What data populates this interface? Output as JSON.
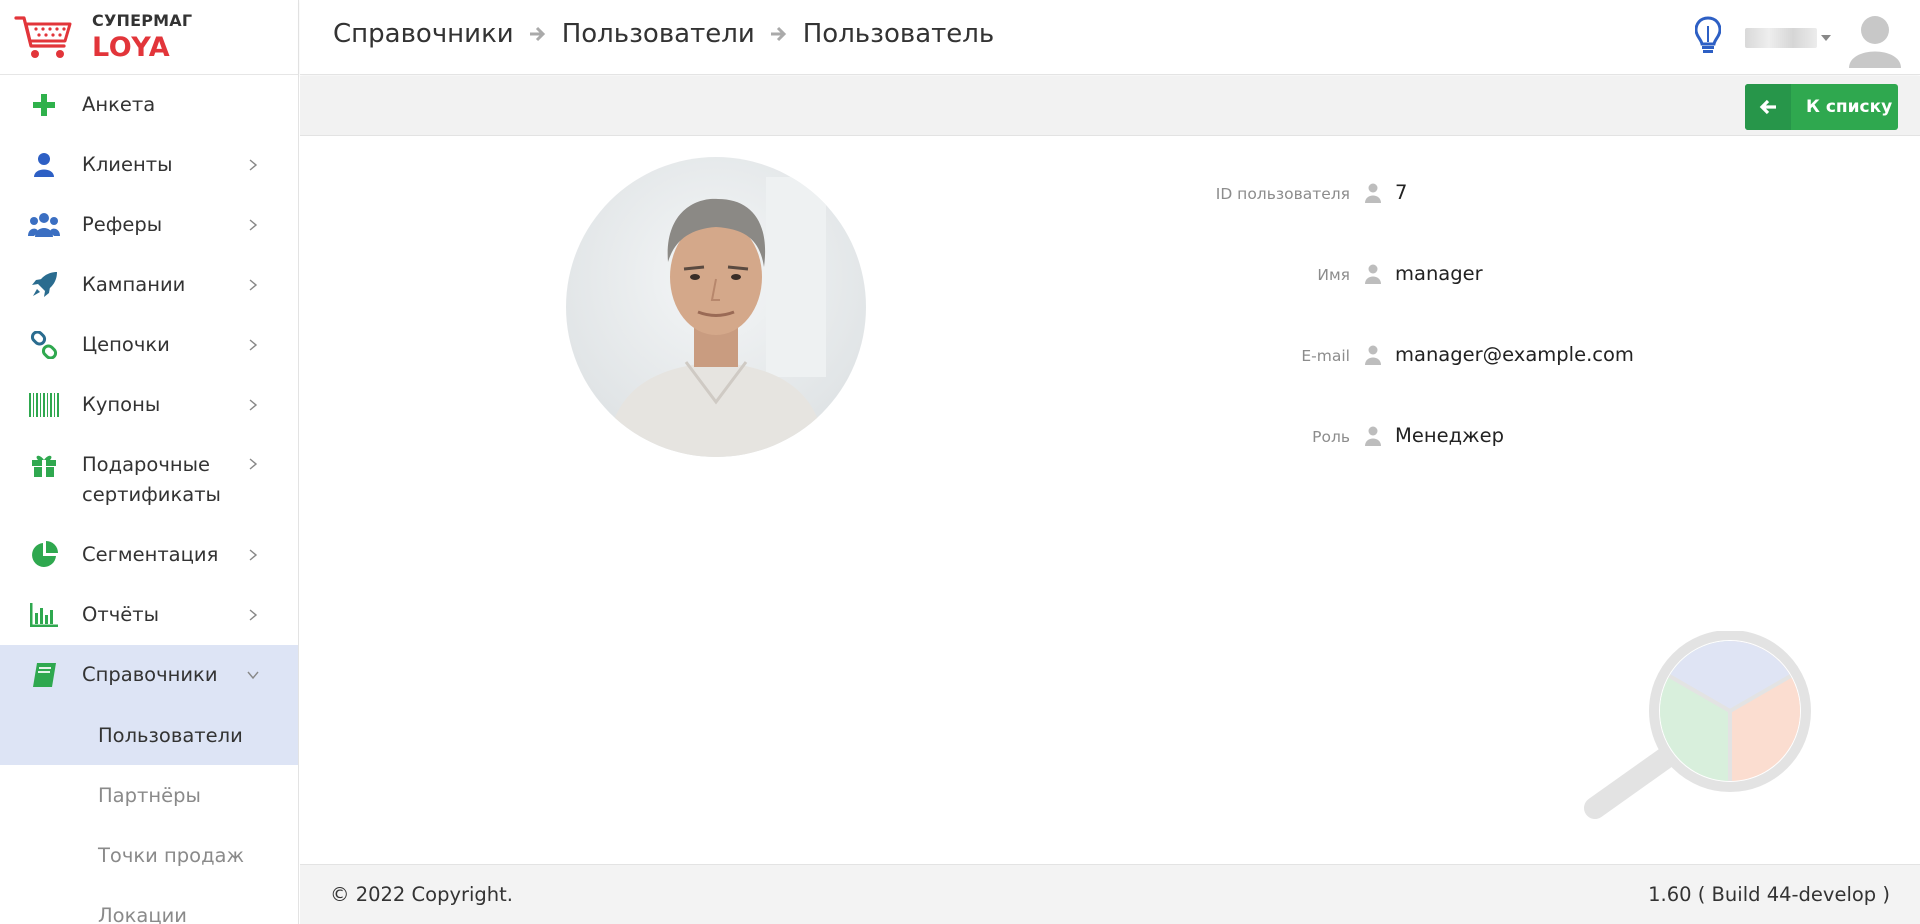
{
  "brand": {
    "top": "СУПЕРМАГ",
    "bottom": "LOYA"
  },
  "breadcrumb": [
    "Справочники",
    "Пользователи",
    "Пользователь"
  ],
  "header": {
    "username": "user"
  },
  "sidebar": {
    "items": [
      {
        "label": "Анкета",
        "icon": "plus-icon"
      },
      {
        "label": "Клиенты",
        "icon": "person-icon"
      },
      {
        "label": "Реферы",
        "icon": "users-icon"
      },
      {
        "label": "Кампании",
        "icon": "rocket-icon"
      },
      {
        "label": "Цепочки",
        "icon": "chain-icon"
      },
      {
        "label": "Купоны",
        "icon": "barcode-icon"
      },
      {
        "label": "Подарочные сертификаты",
        "icon": "gift-icon"
      },
      {
        "label": "Сегментация",
        "icon": "pie-icon"
      },
      {
        "label": "Отчёты",
        "icon": "bar-chart-icon"
      },
      {
        "label": "Справочники",
        "icon": "book-icon"
      }
    ],
    "subitems": [
      "Пользователи",
      "Партнёры",
      "Точки продаж",
      "Локации"
    ]
  },
  "toolbar": {
    "back_label": "К списку"
  },
  "user": {
    "fields": [
      {
        "label": "ID пользователя",
        "value": "7"
      },
      {
        "label": "Имя",
        "value": "manager"
      },
      {
        "label": "E-mail",
        "value": "manager@example.com"
      },
      {
        "label": "Роль",
        "value": "Менеджер"
      }
    ]
  },
  "footer": {
    "copyright": "© 2022 Copyright.",
    "version": "1.60 ( Build 44-develop )"
  },
  "colors": {
    "brand_red": "#e2353a",
    "green": "#2fa84f",
    "active_bg": "#dde4f5",
    "icon_blue": "#2d5fc4"
  }
}
